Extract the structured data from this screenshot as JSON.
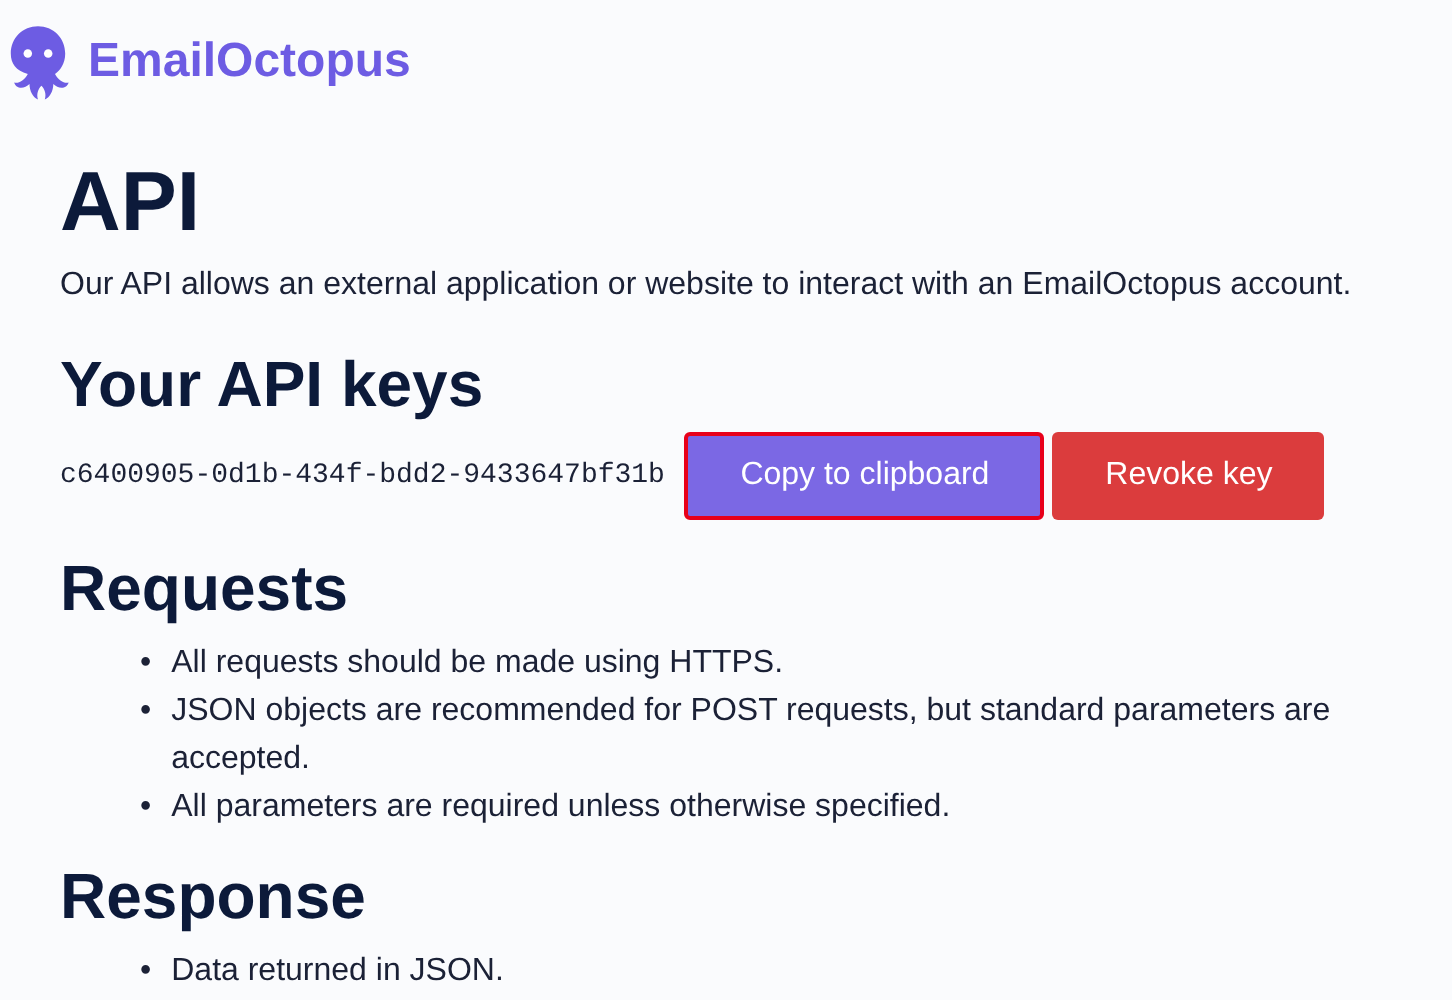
{
  "brand": {
    "name": "EmailOctopus"
  },
  "title": "API",
  "intro": "Our API allows an external application or website to interact with an EmailOctopus account.",
  "keys_heading": "Your API keys",
  "api_key": "c6400905-0d1b-434f-bdd2-9433647bf31b",
  "buttons": [
    {
      "label": "Copy to clipboard",
      "kind": "primary",
      "focused": true
    },
    {
      "label": "Revoke key",
      "kind": "danger",
      "focused": false
    }
  ],
  "sections": [
    {
      "heading": "Requests",
      "items": [
        {
          "marker": "•",
          "text": "All requests should be made using HTTPS."
        },
        {
          "marker": "•",
          "text": "JSON objects are recommended for POST requests, but standard parameters are accepted."
        },
        {
          "marker": "•",
          "text": "All parameters are required unless otherwise specified."
        }
      ]
    },
    {
      "heading": "Response",
      "items": [
        {
          "marker": "•",
          "text": "Data returned in JSON."
        }
      ]
    }
  ]
}
